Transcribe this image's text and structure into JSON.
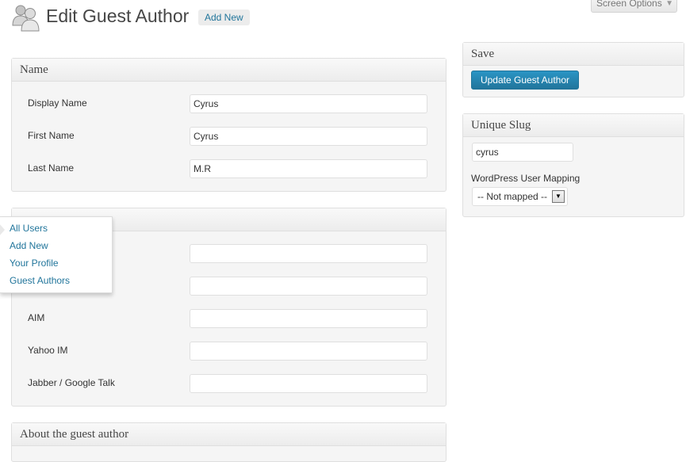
{
  "header": {
    "title": "Edit Guest Author",
    "add_new": "Add New",
    "screen_options": "Screen Options",
    "page_icon": "users-icon"
  },
  "name_box": {
    "title": "Name",
    "fields": [
      {
        "label": "Display Name",
        "value": "Cyrus"
      },
      {
        "label": "First Name",
        "value": "Cyrus"
      },
      {
        "label": "Last Name",
        "value": "M.R"
      }
    ]
  },
  "contact_box": {
    "fields": [
      {
        "label": "",
        "value": ""
      },
      {
        "label": "",
        "value": ""
      },
      {
        "label": "AIM",
        "value": ""
      },
      {
        "label": "Yahoo IM",
        "value": ""
      },
      {
        "label": "Jabber / Google Talk",
        "value": ""
      }
    ]
  },
  "about_box": {
    "title": "About the guest author"
  },
  "save_box": {
    "title": "Save",
    "button": "Update Guest Author"
  },
  "slug_box": {
    "title": "Unique Slug",
    "slug_value": "cyrus",
    "mapping_label": "WordPress User Mapping",
    "mapping_selected": "-- Not mapped --"
  },
  "users_menu": {
    "items": [
      "All Users",
      "Add New",
      "Your Profile",
      "Guest Authors"
    ]
  },
  "colors": {
    "link": "#21759b",
    "primary_button": "#21759b",
    "postbox_bg": "#f5f5f5",
    "border": "#dfdfdf"
  }
}
